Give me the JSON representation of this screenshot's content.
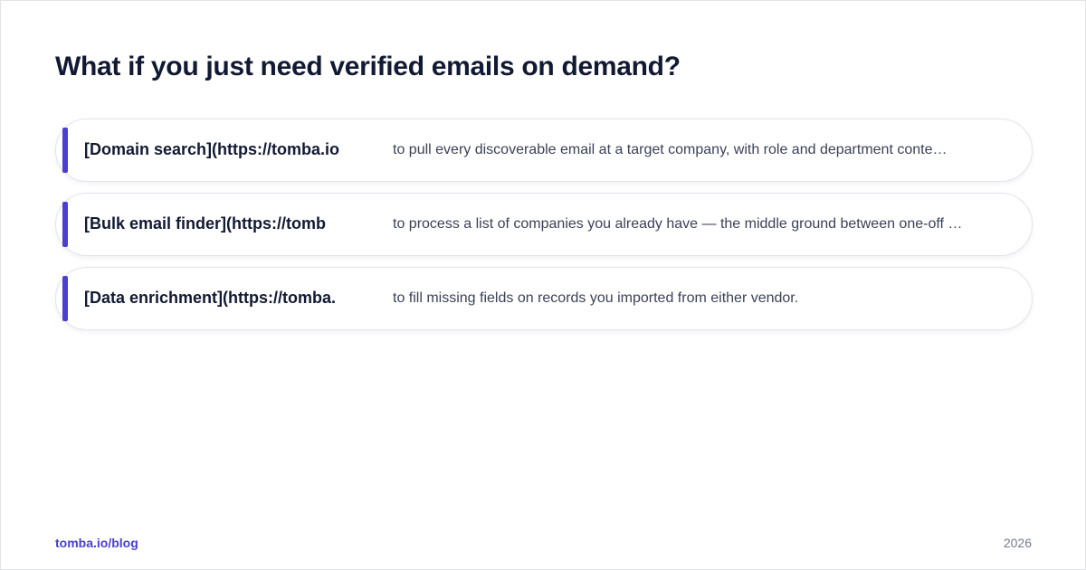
{
  "page": {
    "title": "What if you just need verified emails on demand?"
  },
  "items": [
    {
      "label": "[Domain search](https://tomba.io",
      "description": "to pull every discoverable email at a target company, with role and department conte…"
    },
    {
      "label": "[Bulk email finder](https://tomb",
      "description": "to process a list of companies you already have — the middle ground between one-off …"
    },
    {
      "label": "[Data enrichment](https://tomba.",
      "description": "to fill missing fields on records you imported from either vendor."
    }
  ],
  "footer": {
    "link": "tomba.io/blog",
    "year": "2026"
  },
  "colors": {
    "accent": "#4a3fd0",
    "heading": "#121a33",
    "body_text": "#3b4257",
    "muted": "#747b8c",
    "border": "#e2e4ec"
  }
}
